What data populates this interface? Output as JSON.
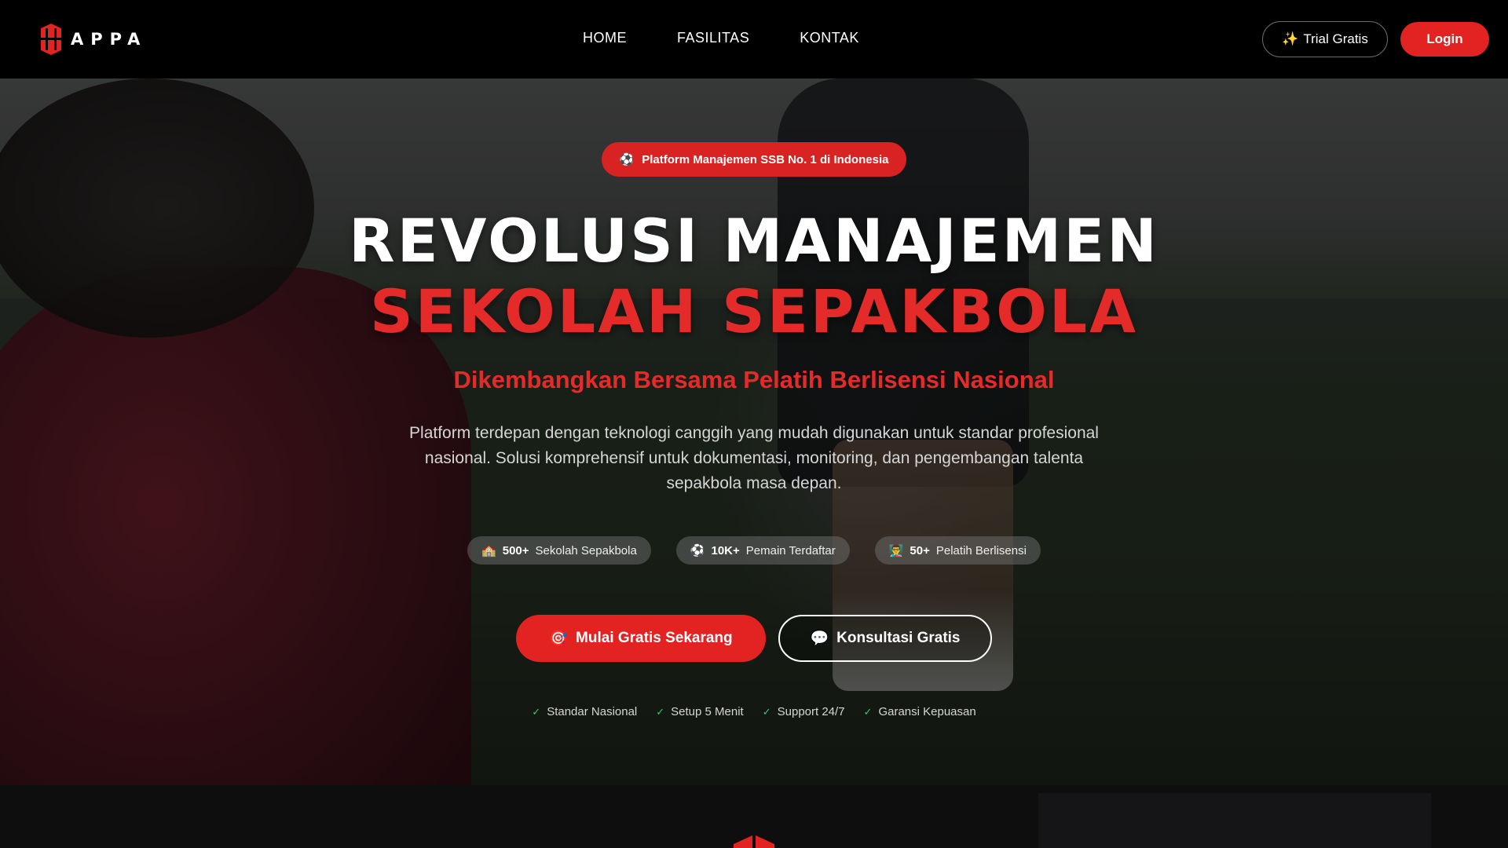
{
  "brand": {
    "name": "APPA",
    "accent": "#e32222"
  },
  "nav": {
    "links": [
      "HOME",
      "FASILITAS",
      "KONTAK"
    ]
  },
  "header_actions": {
    "trial_icon": "✨",
    "trial_label": "Trial Gratis",
    "login_label": "Login"
  },
  "hero": {
    "badge_icon": "⚽",
    "badge": "Platform Manajemen SSB No. 1 di Indonesia",
    "title_line1": "REVOLUSI MANAJEMEN",
    "title_line2": "SEKOLAH SEPAKBOLA",
    "subtitle": "Dikembangkan Bersama Pelatih Berlisensi Nasional",
    "description": "Platform terdepan dengan teknologi canggih yang mudah digunakan untuk standar profesional nasional. Solusi komprehensif untuk dokumentasi, monitoring, dan pengembangan talenta sepakbola masa depan.",
    "stats": [
      {
        "icon": "🏫",
        "value": "500+",
        "label": "Sekolah Sepakbola"
      },
      {
        "icon": "⚽",
        "value": "10K+",
        "label": "Pemain Terdaftar"
      },
      {
        "icon": "👨‍🏫",
        "value": "50+",
        "label": "Pelatih Berlisensi"
      }
    ],
    "cta_primary": {
      "icon": "🎯",
      "label": "Mulai Gratis Sekarang"
    },
    "cta_secondary": {
      "icon": "💬",
      "label": "Konsultasi Gratis"
    },
    "features": [
      "Standar Nasional",
      "Setup 5 Menit",
      "Support 24/7",
      "Garansi Kepuasan"
    ],
    "check_icon": "✓"
  }
}
